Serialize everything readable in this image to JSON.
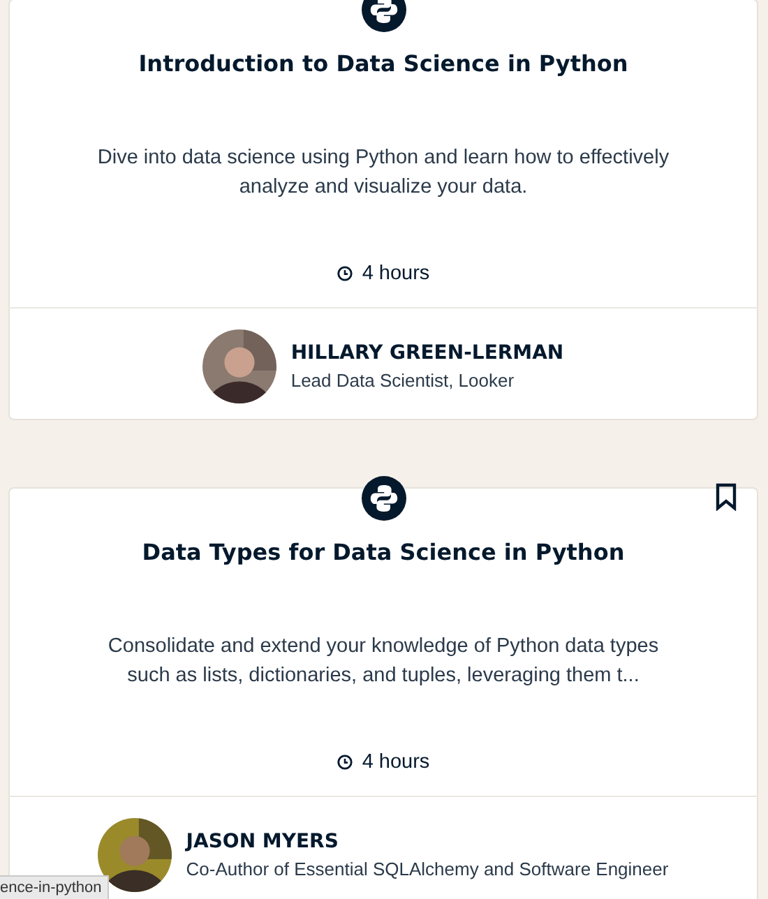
{
  "courses": [
    {
      "title": "Introduction to Data Science in Python",
      "description": "Dive into data science using Python and learn how to effectively analyze and visualize your data.",
      "duration": "4 hours",
      "show_bookmark": false,
      "instructor": {
        "name": "HILLARY GREEN-LERMAN",
        "role": "Lead Data Scientist, Looker"
      }
    },
    {
      "title": "Data Types for Data Science in Python",
      "description": "Consolidate and extend your knowledge of Python data types such as lists, dictionaries, and tuples, leveraging them t...",
      "duration": "4 hours",
      "show_bookmark": true,
      "instructor": {
        "name": "JASON MYERS",
        "role": "Co-Author of Essential SQLAlchemy and Software Engineer"
      }
    }
  ],
  "status_bar": {
    "url": "ence-in-python"
  }
}
